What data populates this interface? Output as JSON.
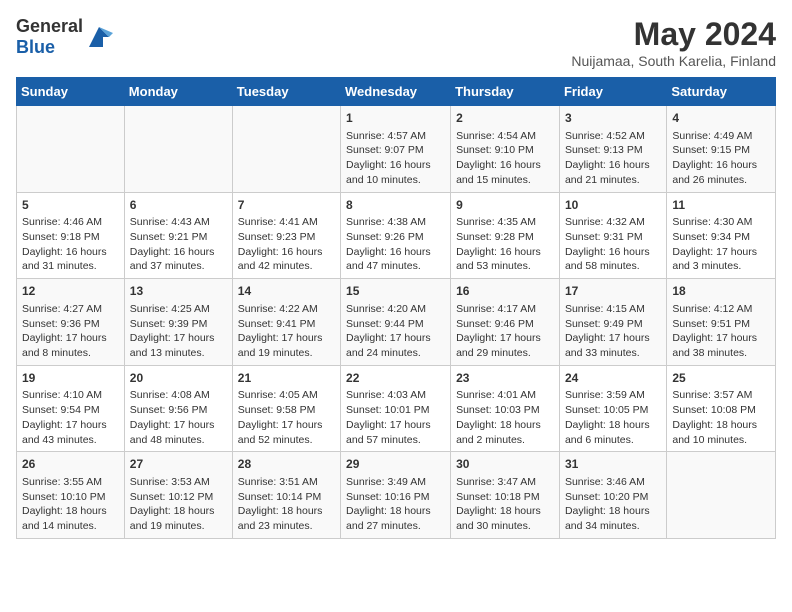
{
  "header": {
    "logo_general": "General",
    "logo_blue": "Blue",
    "month_title": "May 2024",
    "location": "Nuijamaa, South Karelia, Finland"
  },
  "days_of_week": [
    "Sunday",
    "Monday",
    "Tuesday",
    "Wednesday",
    "Thursday",
    "Friday",
    "Saturday"
  ],
  "weeks": [
    [
      {
        "day": "",
        "info": ""
      },
      {
        "day": "",
        "info": ""
      },
      {
        "day": "",
        "info": ""
      },
      {
        "day": "1",
        "info": "Sunrise: 4:57 AM\nSunset: 9:07 PM\nDaylight: 16 hours\nand 10 minutes."
      },
      {
        "day": "2",
        "info": "Sunrise: 4:54 AM\nSunset: 9:10 PM\nDaylight: 16 hours\nand 15 minutes."
      },
      {
        "day": "3",
        "info": "Sunrise: 4:52 AM\nSunset: 9:13 PM\nDaylight: 16 hours\nand 21 minutes."
      },
      {
        "day": "4",
        "info": "Sunrise: 4:49 AM\nSunset: 9:15 PM\nDaylight: 16 hours\nand 26 minutes."
      }
    ],
    [
      {
        "day": "5",
        "info": "Sunrise: 4:46 AM\nSunset: 9:18 PM\nDaylight: 16 hours\nand 31 minutes."
      },
      {
        "day": "6",
        "info": "Sunrise: 4:43 AM\nSunset: 9:21 PM\nDaylight: 16 hours\nand 37 minutes."
      },
      {
        "day": "7",
        "info": "Sunrise: 4:41 AM\nSunset: 9:23 PM\nDaylight: 16 hours\nand 42 minutes."
      },
      {
        "day": "8",
        "info": "Sunrise: 4:38 AM\nSunset: 9:26 PM\nDaylight: 16 hours\nand 47 minutes."
      },
      {
        "day": "9",
        "info": "Sunrise: 4:35 AM\nSunset: 9:28 PM\nDaylight: 16 hours\nand 53 minutes."
      },
      {
        "day": "10",
        "info": "Sunrise: 4:32 AM\nSunset: 9:31 PM\nDaylight: 16 hours\nand 58 minutes."
      },
      {
        "day": "11",
        "info": "Sunrise: 4:30 AM\nSunset: 9:34 PM\nDaylight: 17 hours\nand 3 minutes."
      }
    ],
    [
      {
        "day": "12",
        "info": "Sunrise: 4:27 AM\nSunset: 9:36 PM\nDaylight: 17 hours\nand 8 minutes."
      },
      {
        "day": "13",
        "info": "Sunrise: 4:25 AM\nSunset: 9:39 PM\nDaylight: 17 hours\nand 13 minutes."
      },
      {
        "day": "14",
        "info": "Sunrise: 4:22 AM\nSunset: 9:41 PM\nDaylight: 17 hours\nand 19 minutes."
      },
      {
        "day": "15",
        "info": "Sunrise: 4:20 AM\nSunset: 9:44 PM\nDaylight: 17 hours\nand 24 minutes."
      },
      {
        "day": "16",
        "info": "Sunrise: 4:17 AM\nSunset: 9:46 PM\nDaylight: 17 hours\nand 29 minutes."
      },
      {
        "day": "17",
        "info": "Sunrise: 4:15 AM\nSunset: 9:49 PM\nDaylight: 17 hours\nand 33 minutes."
      },
      {
        "day": "18",
        "info": "Sunrise: 4:12 AM\nSunset: 9:51 PM\nDaylight: 17 hours\nand 38 minutes."
      }
    ],
    [
      {
        "day": "19",
        "info": "Sunrise: 4:10 AM\nSunset: 9:54 PM\nDaylight: 17 hours\nand 43 minutes."
      },
      {
        "day": "20",
        "info": "Sunrise: 4:08 AM\nSunset: 9:56 PM\nDaylight: 17 hours\nand 48 minutes."
      },
      {
        "day": "21",
        "info": "Sunrise: 4:05 AM\nSunset: 9:58 PM\nDaylight: 17 hours\nand 52 minutes."
      },
      {
        "day": "22",
        "info": "Sunrise: 4:03 AM\nSunset: 10:01 PM\nDaylight: 17 hours\nand 57 minutes."
      },
      {
        "day": "23",
        "info": "Sunrise: 4:01 AM\nSunset: 10:03 PM\nDaylight: 18 hours\nand 2 minutes."
      },
      {
        "day": "24",
        "info": "Sunrise: 3:59 AM\nSunset: 10:05 PM\nDaylight: 18 hours\nand 6 minutes."
      },
      {
        "day": "25",
        "info": "Sunrise: 3:57 AM\nSunset: 10:08 PM\nDaylight: 18 hours\nand 10 minutes."
      }
    ],
    [
      {
        "day": "26",
        "info": "Sunrise: 3:55 AM\nSunset: 10:10 PM\nDaylight: 18 hours\nand 14 minutes."
      },
      {
        "day": "27",
        "info": "Sunrise: 3:53 AM\nSunset: 10:12 PM\nDaylight: 18 hours\nand 19 minutes."
      },
      {
        "day": "28",
        "info": "Sunrise: 3:51 AM\nSunset: 10:14 PM\nDaylight: 18 hours\nand 23 minutes."
      },
      {
        "day": "29",
        "info": "Sunrise: 3:49 AM\nSunset: 10:16 PM\nDaylight: 18 hours\nand 27 minutes."
      },
      {
        "day": "30",
        "info": "Sunrise: 3:47 AM\nSunset: 10:18 PM\nDaylight: 18 hours\nand 30 minutes."
      },
      {
        "day": "31",
        "info": "Sunrise: 3:46 AM\nSunset: 10:20 PM\nDaylight: 18 hours\nand 34 minutes."
      },
      {
        "day": "",
        "info": ""
      }
    ]
  ]
}
